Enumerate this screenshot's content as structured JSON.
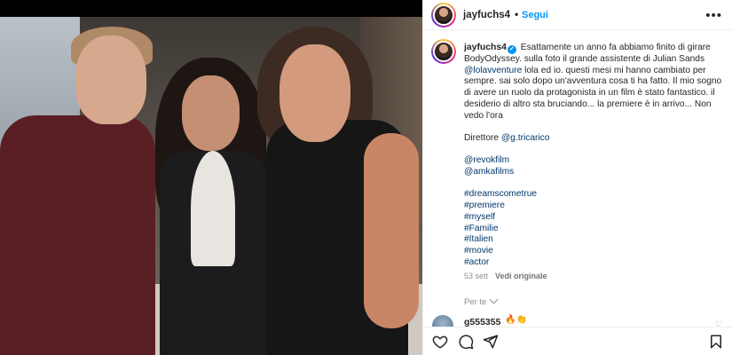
{
  "post": {
    "author": "jayfuchs4",
    "follow_label": "Segui",
    "dot": "•",
    "more_label": "•••",
    "caption_lines": {
      "intro": "Esattamente un anno fa abbiamo finito di girare BodyOdyssey. sulla foto il grande assistente di Julian Sands",
      "mention1": "@lolavventure",
      "after_mention1": " lola ed io. questi mesi mi hanno cambiato per sempre. sai solo dopo un'avventura cosa ti ha fatto. Il mio sogno di avere un ruolo da protagonista in un film è stato fantastico. il desiderio di altro sta bruciando... la premiere è in arrivo... Non vedo l'ora",
      "director_label": "Direttore ",
      "director_mention": "@g.tricarico",
      "mention2": "@revokfilm",
      "mention3": "@amkafilms"
    },
    "hashtags": [
      "#dreamscometrue",
      "#premiere",
      "#myself",
      "#Familie",
      "#Italien",
      "#movie",
      "#actor"
    ],
    "date": "53 sett",
    "see_original": "Vedi originale",
    "for_you": "Per te",
    "comment_preview": {
      "user": "g555355",
      "emoji": "🔥👏"
    },
    "verified_mark": "✓"
  },
  "icons": {
    "like": "heart-icon",
    "comment": "comment-icon",
    "share": "share-icon",
    "save": "bookmark-icon",
    "more": "more-options-icon"
  },
  "colors": {
    "link": "#00376b",
    "follow": "#0095f6",
    "muted": "#8e8e8e",
    "text": "#262626"
  }
}
